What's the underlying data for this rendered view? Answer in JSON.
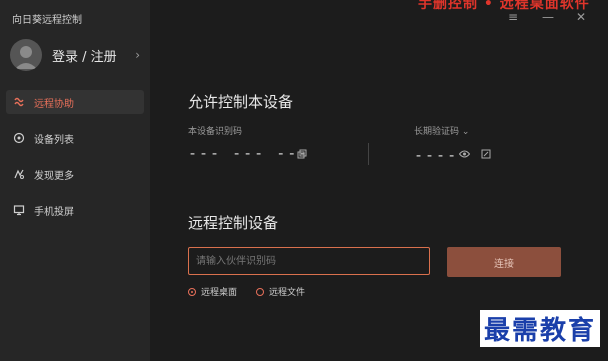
{
  "app": {
    "title": "向日葵远程控制"
  },
  "banner": {
    "text": "手删控制 • 远程桌面软件"
  },
  "user": {
    "login_label": "登录 / 注册"
  },
  "nav": {
    "items": [
      {
        "label": "远程协助",
        "icon": "remote-assist-icon",
        "active": true
      },
      {
        "label": "设备列表",
        "icon": "device-list-icon",
        "active": false
      },
      {
        "label": "发现更多",
        "icon": "discover-icon",
        "active": false
      },
      {
        "label": "手机投屏",
        "icon": "screen-cast-icon",
        "active": false
      }
    ]
  },
  "allow": {
    "title": "允许控制本设备",
    "device_id_label": "本设备识别码",
    "device_id_value": "--- --- ---",
    "verify_label": "长期验证码",
    "verify_value": "----"
  },
  "remote": {
    "title": "远程控制设备",
    "input_placeholder": "请输入伙伴识别码",
    "connect_label": "连接",
    "options": [
      {
        "label": "远程桌面",
        "checked": true
      },
      {
        "label": "远程文件",
        "checked": false
      }
    ]
  },
  "watermark": {
    "text": "最需教育"
  },
  "colors": {
    "accent": "#e8705a",
    "connect_button": "#8c4f3d",
    "sidebar_bg": "#262626",
    "main_bg": "#1c1c1c"
  }
}
